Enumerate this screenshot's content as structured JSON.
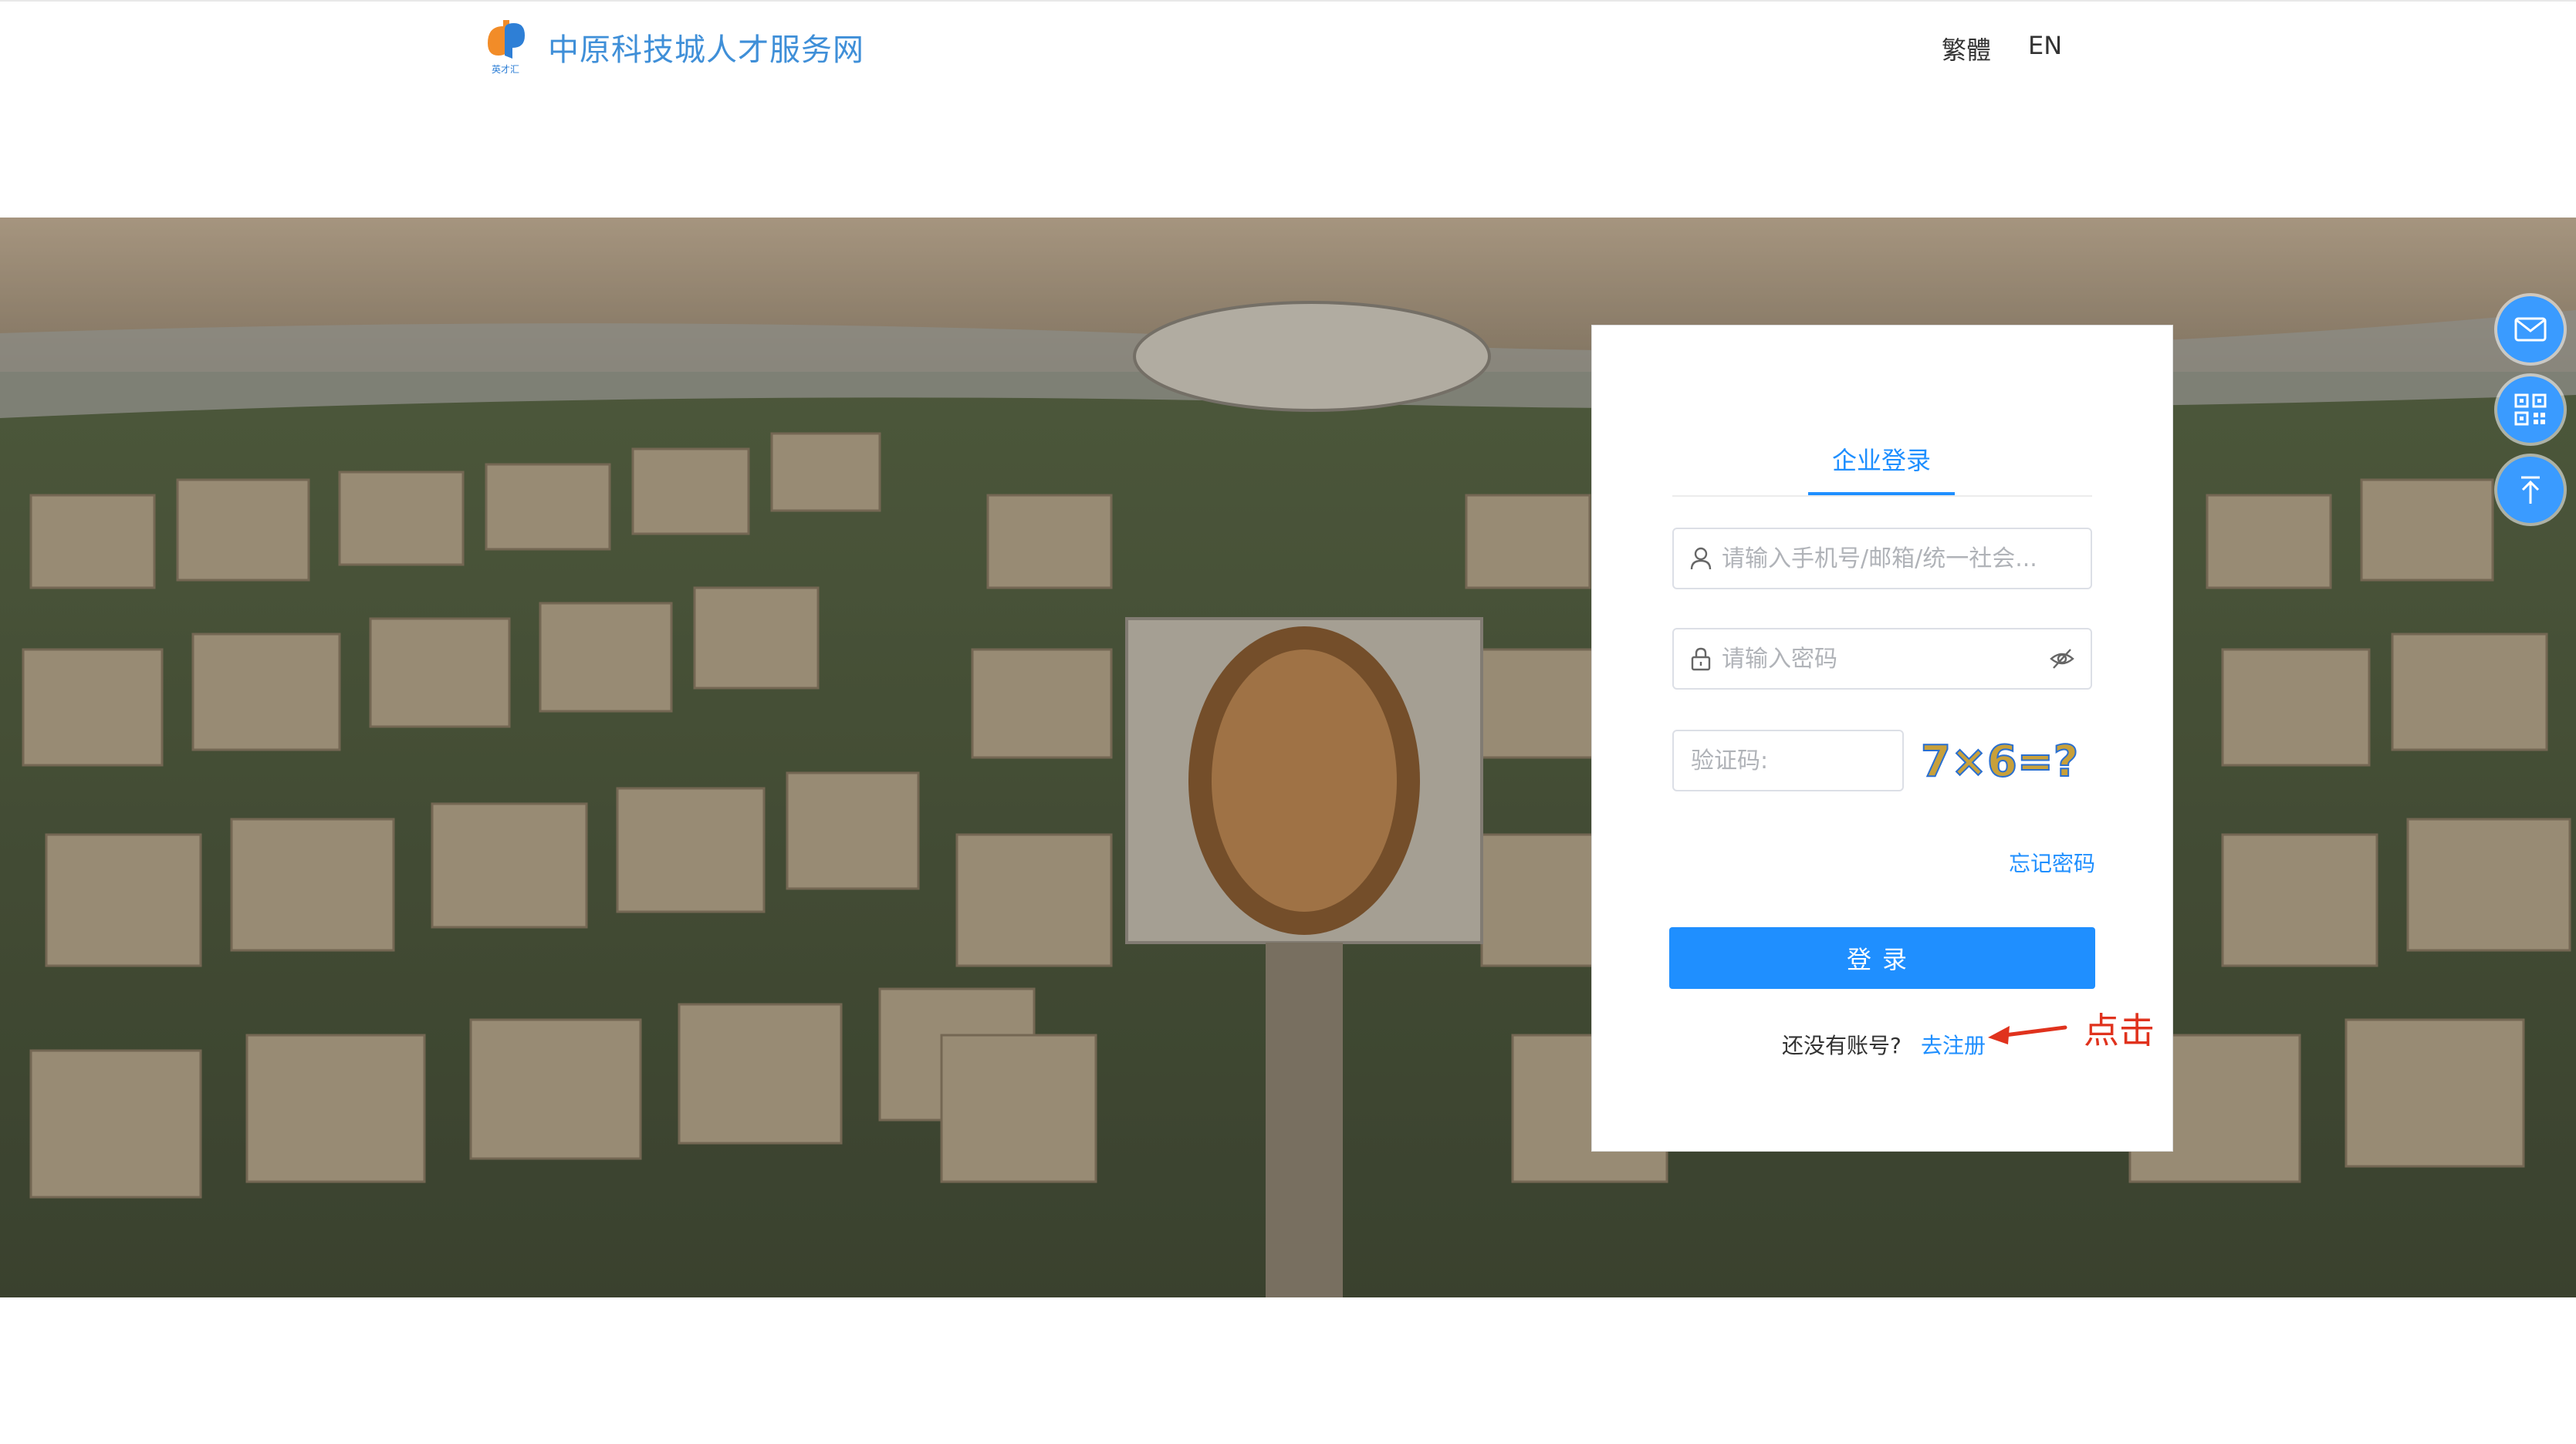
{
  "header": {
    "site_title": "中原科技城人才服务网",
    "logo_text": "英才汇",
    "lang_traditional": "繁體",
    "lang_english": "EN"
  },
  "login": {
    "tab_label": "企业登录",
    "username_placeholder": "请输入手机号/邮箱/统一社会...",
    "password_placeholder": "请输入密码",
    "captcha_placeholder": "验证码:",
    "captcha_text": "7×6=?",
    "forgot_label": "忘记密码",
    "submit_label": "登录",
    "no_account_text": "还没有账号?",
    "register_label": "去注册"
  },
  "annotation": {
    "text": "点击",
    "color": "#e0321d"
  },
  "floating": {
    "items": [
      "mail-icon",
      "qr-code-icon",
      "back-to-top-icon"
    ]
  },
  "colors": {
    "primary": "#1f8fff",
    "title_blue": "#3f8fd8",
    "float_blue": "#3a9bff"
  }
}
